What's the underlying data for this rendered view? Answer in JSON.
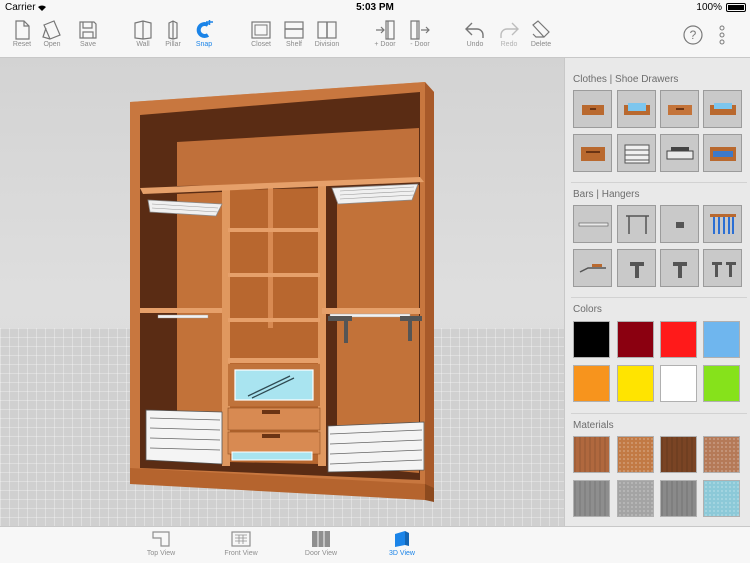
{
  "status_bar": {
    "carrier": "Carrier",
    "time": "5:03 PM",
    "battery": "100%"
  },
  "toolbar": {
    "reset": "Reset",
    "open": "Open",
    "save": "Save",
    "wall": "Wall",
    "pillar": "Pillar",
    "snap": "Snap",
    "closet": "Closet",
    "shelf": "Shelf",
    "division": "Division",
    "add_door": "+ Door",
    "remove_door": "- Door",
    "undo": "Undo",
    "redo": "Redo",
    "delete": "Delete",
    "help_glyph": "?"
  },
  "panel": {
    "clothes_title": "Clothes | Shoe Drawers",
    "bars_title": "Bars | Hangers",
    "colors_title": "Colors",
    "materials_title": "Materials"
  },
  "colors": {
    "accent": "#1b84e8",
    "cabinet": "#c8773f",
    "swatches": [
      "#000000",
      "#8b0010",
      "#ff1a1a",
      "#6fb6ee",
      "#f7941d",
      "#ffe400",
      "#ffffff",
      "#86e21b"
    ],
    "materials": [
      "#b0683e",
      "#c27a45",
      "#7a4424",
      "#b57a58",
      "#8e8e8e",
      "#a4a4a4",
      "#8a8a8a",
      "#8cc9d8"
    ]
  },
  "tabs": {
    "top": "Top View",
    "front": "Front View",
    "door": "Door View",
    "three_d": "3D View"
  }
}
